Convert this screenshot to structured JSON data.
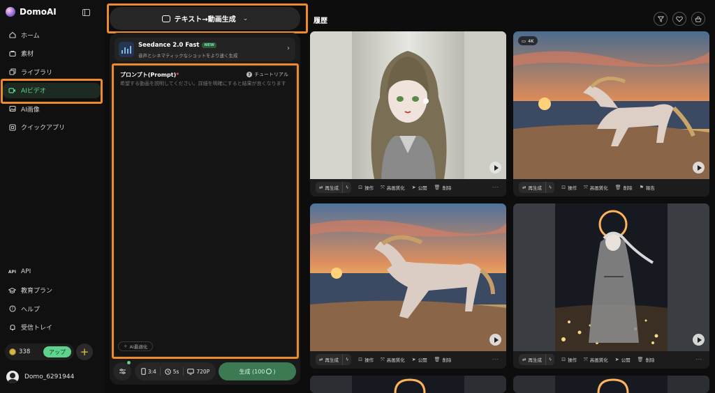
{
  "brand": {
    "name": "DomoAI"
  },
  "nav": [
    {
      "id": "home",
      "label": "ホーム",
      "icon": "home-icon",
      "active": false
    },
    {
      "id": "assets",
      "label": "素材",
      "icon": "assets-icon",
      "active": false
    },
    {
      "id": "library",
      "label": "ライブラリ",
      "icon": "library-icon",
      "active": false
    },
    {
      "id": "ai-video",
      "label": "AIビデオ",
      "icon": "video-icon",
      "active": true
    },
    {
      "id": "ai-image",
      "label": "AI画像",
      "icon": "image-icon",
      "active": false
    },
    {
      "id": "quick-apps",
      "label": "クイックアプリ",
      "icon": "apps-icon",
      "active": false
    }
  ],
  "nav_bottom": [
    {
      "id": "api",
      "label": "API",
      "icon": "api-icon"
    },
    {
      "id": "education",
      "label": "教育プラン",
      "icon": "graduation-cap-icon"
    },
    {
      "id": "help",
      "label": "ヘルプ",
      "icon": "help-icon"
    },
    {
      "id": "inbox",
      "label": "受信トレイ",
      "icon": "bell-icon"
    }
  ],
  "credits": {
    "count": "338",
    "upgrade_label": "アップ"
  },
  "user": {
    "name": "Domo_6291944"
  },
  "mode": {
    "label": "テキスト→動画生成"
  },
  "model": {
    "name": "Seedance 2.0 Fast",
    "badge": "NEW",
    "description": "音声とシネマティックなショットをより速く生成"
  },
  "prompt": {
    "label": "プロンプト(Prompt)",
    "required_mark": "*",
    "tutorial_label": "チュートリアル",
    "placeholder": "希望する動画を説明してください。詳細を明確にすると結果が良くなります",
    "ai_optimize_label": "AI最適化"
  },
  "options": {
    "ratio": "3:4",
    "duration": "5s",
    "resolution": "720P"
  },
  "generate": {
    "label": "生成 (100",
    "suffix": ")"
  },
  "history": {
    "title": "履歴",
    "cards": [
      {
        "id": "girl",
        "badge": "",
        "actions": [
          "再生成",
          "操作",
          "高画質化",
          "公開",
          "削除"
        ]
      },
      {
        "id": "horse-4k",
        "badge": "4K",
        "actions": [
          "再生成",
          "操作",
          "高画質化",
          "削除",
          "報告"
        ]
      },
      {
        "id": "horse",
        "badge": "",
        "actions": [
          "再生成",
          "操作",
          "高画質化",
          "公開",
          "削除"
        ]
      },
      {
        "id": "moon-girl",
        "badge": "",
        "actions": [
          "再生成",
          "操作",
          "高画質化",
          "公開",
          "削除"
        ]
      }
    ]
  },
  "colors": {
    "accent": "#5fd38b",
    "highlight": "#ee8a2e",
    "generate": "#3c7a53"
  }
}
